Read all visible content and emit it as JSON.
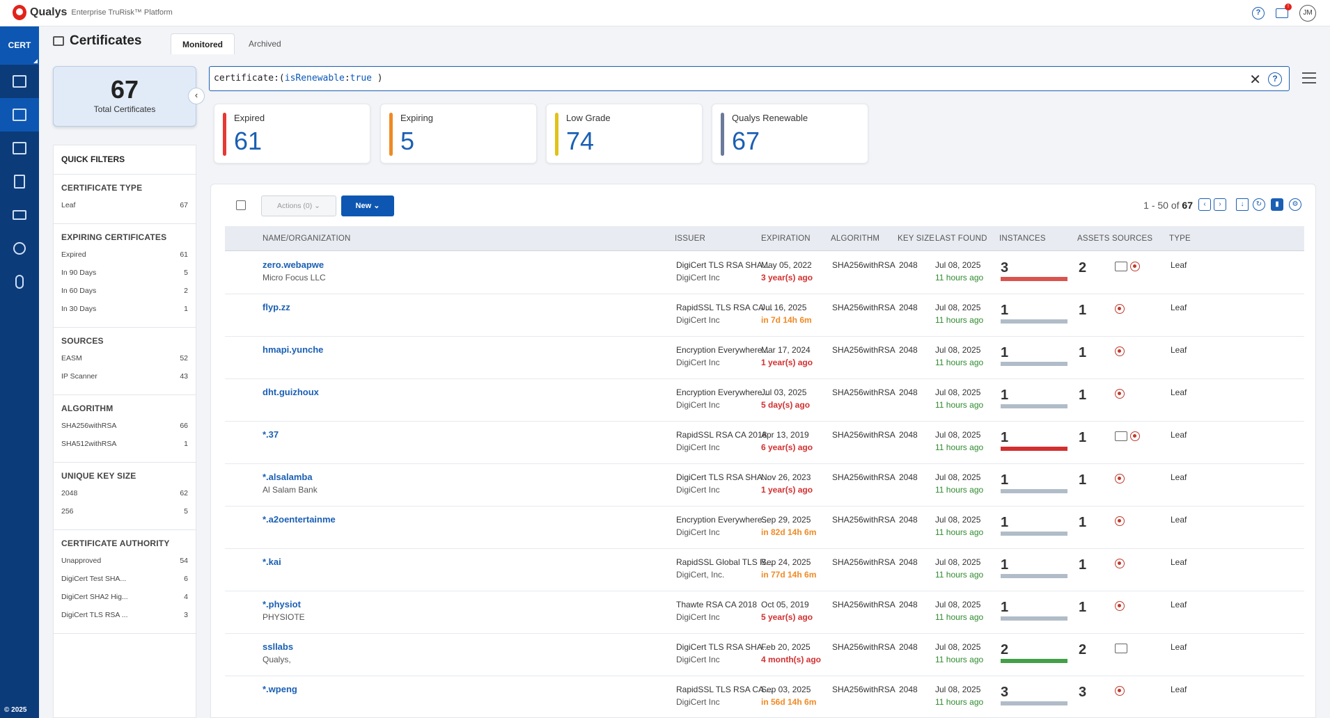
{
  "brand": {
    "name": "Qualys",
    "sub": "Enterprise TruRisk™ Platform"
  },
  "user": {
    "initials": "JM"
  },
  "nav": {
    "module": "CERT",
    "footer": "© 2025"
  },
  "page": {
    "title": "Certificates",
    "tabs": [
      "Monitored",
      "Archived"
    ]
  },
  "total": {
    "value": "67",
    "label": "Total Certificates"
  },
  "search": {
    "prefix": "certificate:(",
    "field": "isRenewable",
    "sep": ":",
    "value": "true",
    "suffix": " )"
  },
  "stats": [
    {
      "label": "Expired",
      "value": "61",
      "color": "#e53935"
    },
    {
      "label": "Expiring",
      "value": "5",
      "color": "#f08a24"
    },
    {
      "label": "Low Grade",
      "value": "74",
      "color": "#e0c21a"
    },
    {
      "label": "Qualys Renewable",
      "value": "67",
      "color": "#6b7a99"
    }
  ],
  "quick_filters": {
    "title": "QUICK FILTERS",
    "sections": [
      {
        "title": "CERTIFICATE TYPE",
        "items": [
          {
            "label": "Leaf",
            "count": "67"
          }
        ]
      },
      {
        "title": "EXPIRING CERTIFICATES",
        "items": [
          {
            "label": "Expired",
            "count": "61"
          },
          {
            "label": "In 90 Days",
            "count": "5"
          },
          {
            "label": "In 60 Days",
            "count": "2"
          },
          {
            "label": "In 30 Days",
            "count": "1"
          }
        ]
      },
      {
        "title": "SOURCES",
        "items": [
          {
            "label": "EASM",
            "count": "52"
          },
          {
            "label": "IP Scanner",
            "count": "43"
          }
        ]
      },
      {
        "title": "ALGORITHM",
        "items": [
          {
            "label": "SHA256withRSA",
            "count": "66"
          },
          {
            "label": "SHA512withRSA",
            "count": "1"
          }
        ]
      },
      {
        "title": "UNIQUE KEY SIZE",
        "items": [
          {
            "label": "2048",
            "count": "62"
          },
          {
            "label": "256",
            "count": "5"
          }
        ]
      },
      {
        "title": "CERTIFICATE AUTHORITY",
        "items": [
          {
            "label": "Unapproved",
            "count": "54"
          },
          {
            "label": "DigiCert Test SHA...",
            "count": "6"
          },
          {
            "label": "DigiCert SHA2 Hig...",
            "count": "4"
          },
          {
            "label": "DigiCert TLS RSA ...",
            "count": "3"
          }
        ]
      }
    ]
  },
  "toolbar": {
    "actions_label": "Actions (0)",
    "new_label": "New",
    "pager_range": "1 - 50 of",
    "pager_total": "67"
  },
  "columns": [
    "NAME/ORGANIZATION",
    "ISSUER",
    "EXPIRATION",
    "ALGORITHM",
    "KEY SIZE",
    "LAST FOUND",
    "INSTANCES",
    "ASSETS",
    "SOURCES",
    "TYPE"
  ],
  "rows": [
    {
      "name": "zero.webapwe",
      "org": "Micro Focus LLC",
      "issuer": "DigiCert TLS RSA SHA...",
      "issuer_org": "DigiCert Inc",
      "exp": "May 05, 2022",
      "exp_rel": "3 year(s) ago",
      "exp_color": "#d32f2f",
      "alg": "SHA256withRSA",
      "key": "2048",
      "found": "Jul 08, 2025",
      "found_rel": "11 hours ago",
      "instances": "3",
      "bar": "#d9534f",
      "assets": "2",
      "sources": [
        "easm",
        "scan"
      ],
      "type": "Leaf"
    },
    {
      "name": "flyp.zz",
      "org": "",
      "issuer": "RapidSSL TLS RSA CA ...",
      "issuer_org": "DigiCert Inc",
      "exp": "Jul 16, 2025",
      "exp_rel": "in 7d 14h 6m",
      "exp_color": "#f08a24",
      "alg": "SHA256withRSA",
      "key": "2048",
      "found": "Jul 08, 2025",
      "found_rel": "11 hours ago",
      "instances": "1",
      "bar": "#b0bcc8",
      "assets": "1",
      "sources": [
        "scan"
      ],
      "type": "Leaf"
    },
    {
      "name": "hmapi.yunche",
      "org": "",
      "issuer": "Encryption Everywhere...",
      "issuer_org": "DigiCert Inc",
      "exp": "Mar 17, 2024",
      "exp_rel": "1 year(s) ago",
      "exp_color": "#d32f2f",
      "alg": "SHA256withRSA",
      "key": "2048",
      "found": "Jul 08, 2025",
      "found_rel": "11 hours ago",
      "instances": "1",
      "bar": "#b0bcc8",
      "assets": "1",
      "sources": [
        "scan"
      ],
      "type": "Leaf"
    },
    {
      "name": "dht.guizhoux",
      "org": "",
      "issuer": "Encryption Everywhere...",
      "issuer_org": "DigiCert Inc",
      "exp": "Jul 03, 2025",
      "exp_rel": "5 day(s) ago",
      "exp_color": "#d32f2f",
      "alg": "SHA256withRSA",
      "key": "2048",
      "found": "Jul 08, 2025",
      "found_rel": "11 hours ago",
      "instances": "1",
      "bar": "#b0bcc8",
      "assets": "1",
      "sources": [
        "scan"
      ],
      "type": "Leaf"
    },
    {
      "name": "*.37",
      "org": "",
      "issuer": "RapidSSL RSA CA 2018",
      "issuer_org": "DigiCert Inc",
      "exp": "Apr 13, 2019",
      "exp_rel": "6 year(s) ago",
      "exp_color": "#d32f2f",
      "alg": "SHA256withRSA",
      "key": "2048",
      "found": "Jul 08, 2025",
      "found_rel": "11 hours ago",
      "instances": "1",
      "bar": "#d32f2f",
      "assets": "1",
      "sources": [
        "easm",
        "scan"
      ],
      "type": "Leaf"
    },
    {
      "name": "*.alsalamba",
      "org": "Al Salam Bank",
      "issuer": "DigiCert TLS RSA SHA...",
      "issuer_org": "DigiCert Inc",
      "exp": "Nov 26, 2023",
      "exp_rel": "1 year(s) ago",
      "exp_color": "#d32f2f",
      "alg": "SHA256withRSA",
      "key": "2048",
      "found": "Jul 08, 2025",
      "found_rel": "11 hours ago",
      "instances": "1",
      "bar": "#b0bcc8",
      "assets": "1",
      "sources": [
        "scan"
      ],
      "type": "Leaf"
    },
    {
      "name": "*.a2oentertainme",
      "org": "",
      "issuer": "Encryption Everywhere...",
      "issuer_org": "DigiCert Inc",
      "exp": "Sep 29, 2025",
      "exp_rel": "in 82d 14h 6m",
      "exp_color": "#f08a24",
      "alg": "SHA256withRSA",
      "key": "2048",
      "found": "Jul 08, 2025",
      "found_rel": "11 hours ago",
      "instances": "1",
      "bar": "#b0bcc8",
      "assets": "1",
      "sources": [
        "scan"
      ],
      "type": "Leaf"
    },
    {
      "name": "*.kai",
      "org": "",
      "issuer": "RapidSSL Global TLS R...",
      "issuer_org": "DigiCert, Inc.",
      "exp": "Sep 24, 2025",
      "exp_rel": "in 77d 14h 6m",
      "exp_color": "#f08a24",
      "alg": "SHA256withRSA",
      "key": "2048",
      "found": "Jul 08, 2025",
      "found_rel": "11 hours ago",
      "instances": "1",
      "bar": "#b0bcc8",
      "assets": "1",
      "sources": [
        "scan"
      ],
      "type": "Leaf"
    },
    {
      "name": "*.physiot",
      "org": "PHYSIOTE",
      "issuer": "Thawte RSA CA 2018",
      "issuer_org": "DigiCert Inc",
      "exp": "Oct 05, 2019",
      "exp_rel": "5 year(s) ago",
      "exp_color": "#d32f2f",
      "alg": "SHA256withRSA",
      "key": "2048",
      "found": "Jul 08, 2025",
      "found_rel": "11 hours ago",
      "instances": "1",
      "bar": "#b0bcc8",
      "assets": "1",
      "sources": [
        "scan"
      ],
      "type": "Leaf"
    },
    {
      "name": "ssllabs",
      "org": "Qualys,",
      "issuer": "DigiCert TLS RSA SHA...",
      "issuer_org": "DigiCert Inc",
      "exp": "Feb 20, 2025",
      "exp_rel": "4 month(s) ago",
      "exp_color": "#d32f2f",
      "alg": "SHA256withRSA",
      "key": "2048",
      "found": "Jul 08, 2025",
      "found_rel": "11 hours ago",
      "instances": "2",
      "bar": "#43a047",
      "assets": "2",
      "sources": [
        "easm"
      ],
      "type": "Leaf"
    },
    {
      "name": "*.wpeng",
      "org": "",
      "issuer": "RapidSSL TLS RSA CA ...",
      "issuer_org": "DigiCert Inc",
      "exp": "Sep 03, 2025",
      "exp_rel": "in 56d 14h 6m",
      "exp_color": "#f08a24",
      "alg": "SHA256withRSA",
      "key": "2048",
      "found": "Jul 08, 2025",
      "found_rel": "11 hours ago",
      "instances": "3",
      "bar": "#b0bcc8",
      "assets": "3",
      "sources": [
        "scan"
      ],
      "type": "Leaf"
    }
  ]
}
